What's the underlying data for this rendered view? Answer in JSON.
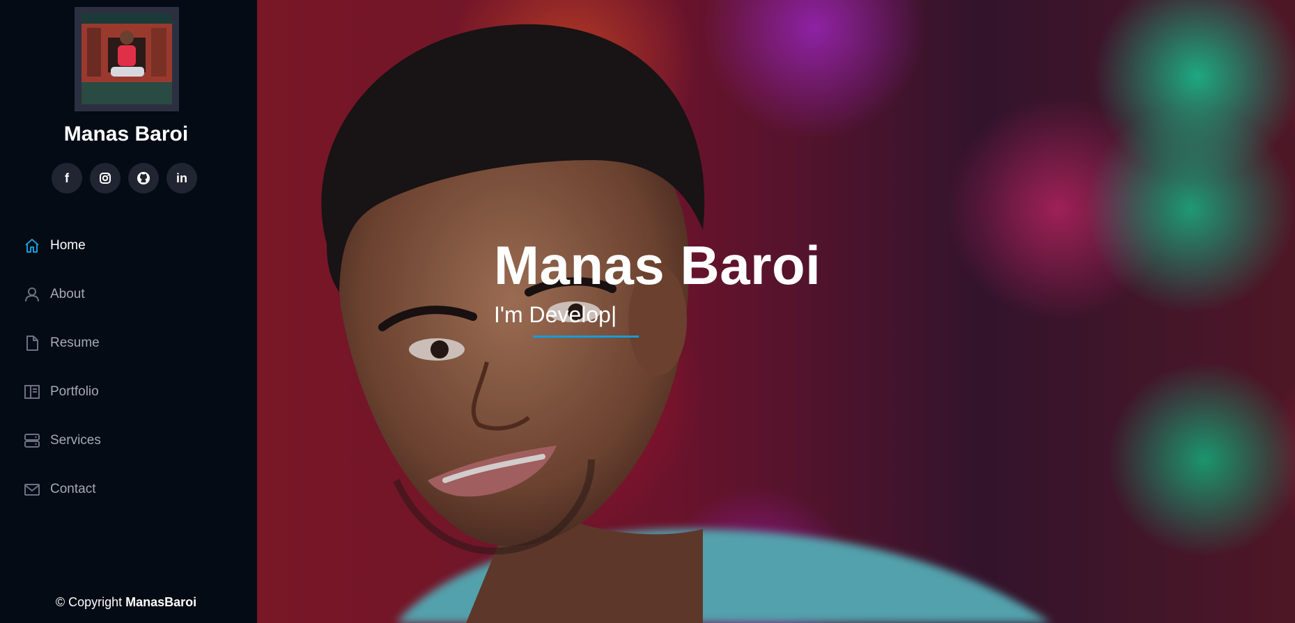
{
  "sidebar": {
    "profile_name": "Manas Baroi",
    "social": [
      {
        "icon": "facebook-icon",
        "glyph": "f"
      },
      {
        "icon": "instagram-icon",
        "glyph": ""
      },
      {
        "icon": "github-icon",
        "glyph": ""
      },
      {
        "icon": "linkedin-icon",
        "glyph": "in"
      }
    ],
    "nav": [
      {
        "label": "Home",
        "icon": "home-icon",
        "active": true
      },
      {
        "label": "About",
        "icon": "person-icon",
        "active": false
      },
      {
        "label": "Resume",
        "icon": "file-icon",
        "active": false
      },
      {
        "label": "Portfolio",
        "icon": "book-half-icon",
        "active": false
      },
      {
        "label": "Services",
        "icon": "server-icon",
        "active": false
      },
      {
        "label": "Contact",
        "icon": "envelope-icon",
        "active": false
      }
    ],
    "copyright_prefix": "© Copyright",
    "copyright_name": "ManasBaroi"
  },
  "hero": {
    "title": "Manas Baroi",
    "subtitle": "I'm Develop|"
  },
  "colors": {
    "sidebar_bg": "#040b14",
    "accent": "#149ddd",
    "social_bg": "#212431",
    "nav_text": "#a8a9b4"
  }
}
